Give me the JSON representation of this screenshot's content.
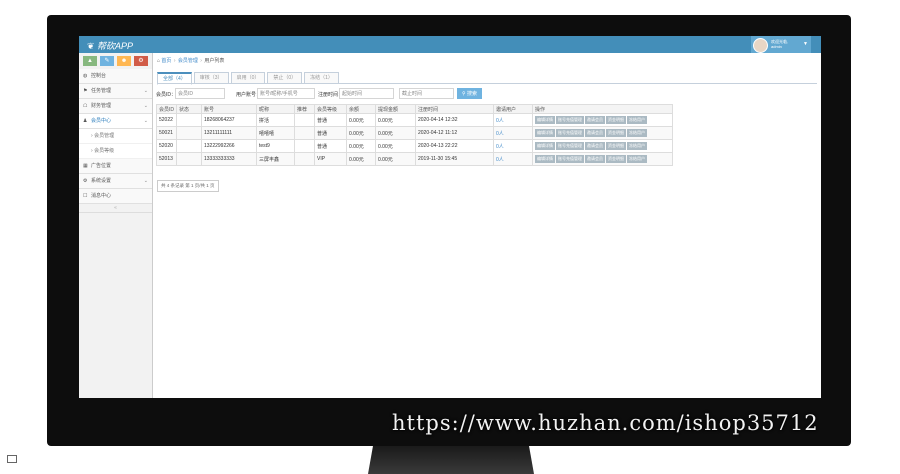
{
  "watermark": "https://www.huzhan.com/ishop35712",
  "topbar": {
    "brand": "帮砍APP",
    "user_line1": "欢迎光临,",
    "user_line2": "admin"
  },
  "sidebar": {
    "shortcuts": [
      {
        "icon": "signal-icon",
        "glyph": "▲",
        "color": "#87b87f"
      },
      {
        "icon": "pencil-icon",
        "glyph": "✎",
        "color": "#6fb3e0"
      },
      {
        "icon": "users-icon",
        "glyph": "☻",
        "color": "#ffb752"
      },
      {
        "icon": "cogs-icon",
        "glyph": "⚙",
        "color": "#d15b47"
      }
    ],
    "items": [
      {
        "label": "控制台",
        "glyph": "◍"
      },
      {
        "label": "任务管理",
        "glyph": "⚑"
      },
      {
        "label": "财务管理",
        "glyph": "☖"
      },
      {
        "label": "会员中心",
        "glyph": "♟"
      },
      {
        "label": "会员管理"
      },
      {
        "label": "会员等级"
      },
      {
        "label": "广告位置",
        "glyph": "▦"
      },
      {
        "label": "系统设置",
        "glyph": "⚙"
      },
      {
        "label": "消息中心",
        "glyph": "☐"
      }
    ]
  },
  "breadcrumb": {
    "home": "首页",
    "section": "会员管理",
    "page": "用户列表"
  },
  "tabs": [
    "全部（4）",
    "审核（3）",
    "启用（0）",
    "禁止（0）",
    "冻结（1）"
  ],
  "filters": {
    "user_id_label": "会员ID：",
    "user_id_placeholder": "会员ID",
    "account_label": "用户账号：",
    "account_placeholder": "账号/昵称/手机号",
    "reg_label": "注册时间：",
    "reg_start_placeholder": "起始时间",
    "reg_end_placeholder": "截止时间",
    "search_label": "搜索"
  },
  "table": {
    "headers": [
      "会员ID",
      "状态",
      "账号",
      "昵称",
      "推荐",
      "会员等级",
      "余额",
      "提现金额",
      "注册时间",
      "邀请用户",
      "操作"
    ],
    "rows": [
      [
        "52022",
        "",
        "18268064237",
        "拼活",
        "",
        "普通",
        "0.00元",
        "0.00元",
        "2020-04-14 12:32",
        "0人"
      ],
      [
        "50021",
        "",
        "13211111111",
        "嘻嘻嘻",
        "",
        "普通",
        "0.00元",
        "0.00元",
        "2020-04-12 11:12",
        "0人"
      ],
      [
        "52020",
        "",
        "13222992266",
        "test9",
        "",
        "普通",
        "0.00元",
        "0.00元",
        "2020-04-13 22:22",
        "0人"
      ],
      [
        "52013",
        "",
        "13333333333",
        "三屏丰鑫",
        "",
        "VIP",
        "0.00元",
        "0.00元",
        "2019-11-30 15:45",
        "0人"
      ]
    ],
    "actions": [
      "编辑详情",
      "账号充值管理",
      "邀请会员",
      "资金明细",
      "冻结用户"
    ]
  },
  "pager": "共 4 条记录 第 1 页/共 1 页"
}
